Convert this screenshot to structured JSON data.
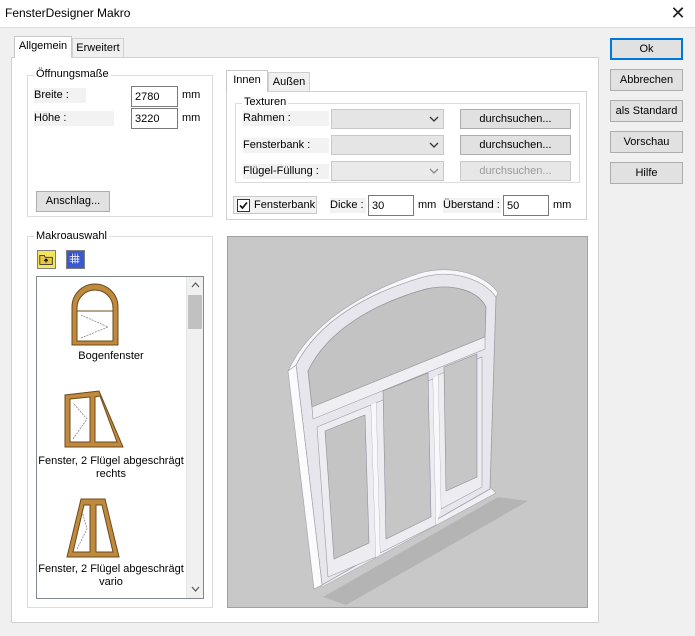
{
  "window": {
    "title": "FensterDesigner Makro",
    "close_glyph": "✕"
  },
  "tabs": {
    "general": "Allgemein",
    "extended": "Erweitert"
  },
  "opening": {
    "legend": "Öffnungsmaße",
    "width_label": "Breite :",
    "width_value": "2780",
    "width_unit": "mm",
    "height_label": "Höhe :",
    "height_value": "3220",
    "height_unit": "mm",
    "stop_button": "Anschlag..."
  },
  "side_tabs": {
    "inner": "Innen",
    "outer": "Außen"
  },
  "textures": {
    "legend": "Texturen",
    "rows": [
      {
        "label": "Rahmen :",
        "value": "",
        "button": "durchsuchen...",
        "enabled": true
      },
      {
        "label": "Fensterbank :",
        "value": "",
        "button": "durchsuchen...",
        "enabled": true
      },
      {
        "label": "Flügel-Füllung :",
        "value": "",
        "button": "durchsuchen...",
        "enabled": false
      }
    ]
  },
  "sill": {
    "checkbox_label": "Fensterbank",
    "checked": true,
    "depth_label": "Dicke :",
    "depth_value": "30",
    "depth_unit": "mm",
    "overhang_label": "Überstand :",
    "overhang_value": "50",
    "overhang_unit": "mm"
  },
  "macro": {
    "legend": "Makroauswahl",
    "tool_icons": [
      "folder-up-icon",
      "grid-view-icon"
    ],
    "items": [
      {
        "label": "Bogenfenster",
        "icon": "arched-window-icon"
      },
      {
        "label": "Fenster, 2 Flügel abgeschrägt rechts",
        "icon": "two-sash-slanted-right-icon"
      },
      {
        "label": "Fenster, 2 Flügel abgeschrägt vario",
        "icon": "two-sash-slanted-vario-icon"
      }
    ]
  },
  "actions": {
    "ok": "Ok",
    "cancel": "Abbrechen",
    "as_default": "als Standard",
    "preview": "Vorschau",
    "help": "Hilfe"
  },
  "colors": {
    "accent": "#0078d7",
    "wood": "#c08a3e",
    "glass": "#c9c9c9",
    "frame": "#e4e4ea"
  }
}
